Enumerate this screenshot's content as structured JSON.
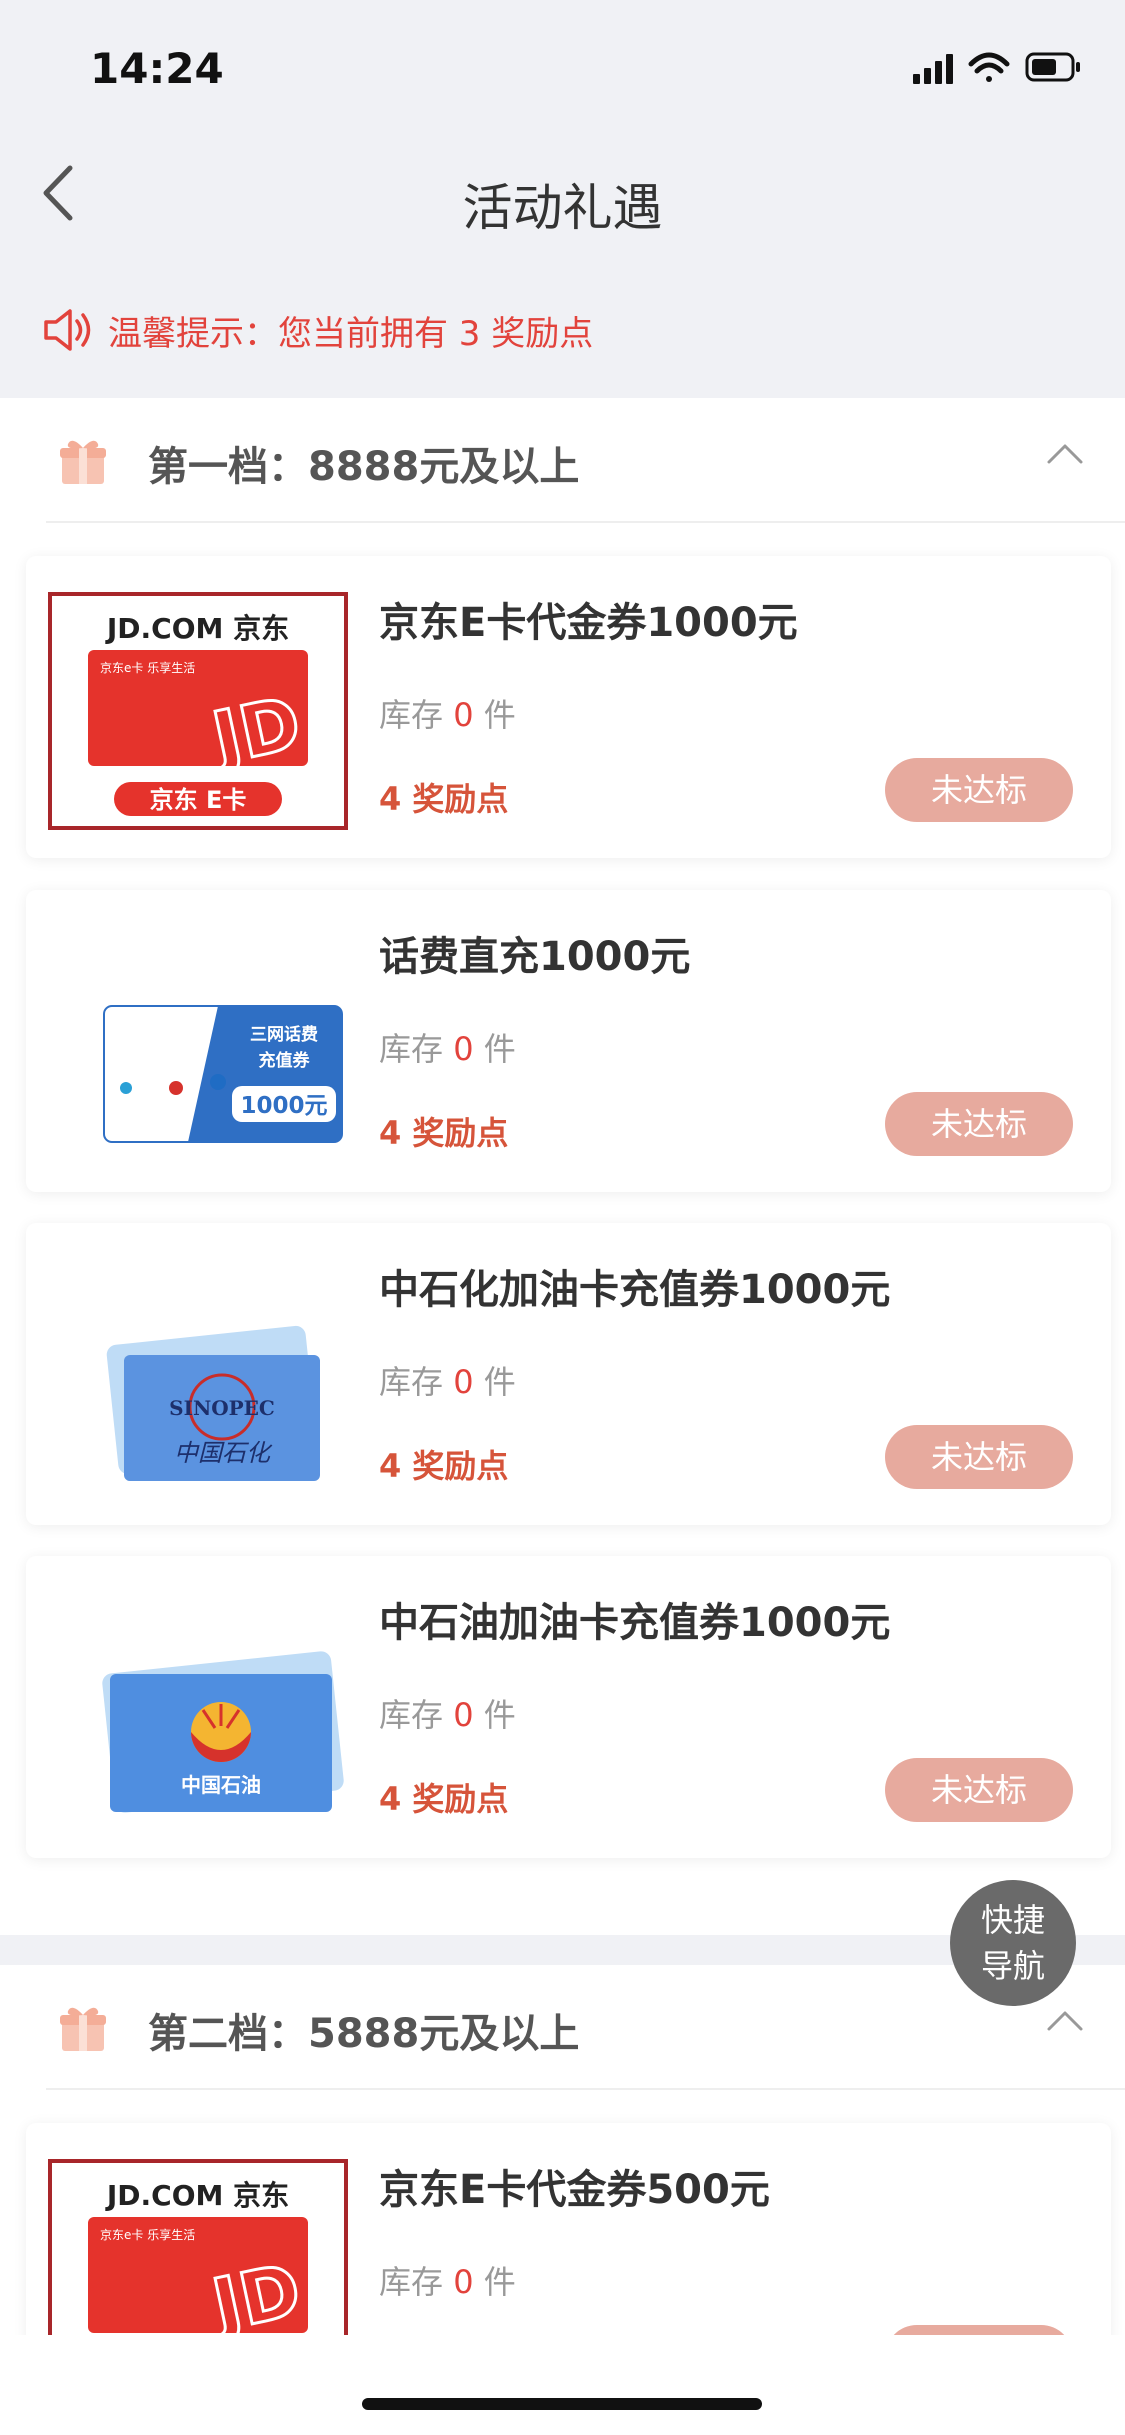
{
  "status": {
    "time": "14:24"
  },
  "nav": {
    "title": "活动礼遇"
  },
  "tip": {
    "text": "温馨提示：您当前拥有 3 奖励点"
  },
  "tiers": [
    {
      "label": "第一档：8888元及以上",
      "items": [
        {
          "name": "京东E卡代金券1000元",
          "stock_prefix": "库存 ",
          "stock_num": "0",
          "stock_suffix": " 件",
          "points": "4 奖励点",
          "button": "未达标"
        },
        {
          "name": "话费直充1000元",
          "stock_prefix": "库存 ",
          "stock_num": "0",
          "stock_suffix": " 件",
          "points": "4 奖励点",
          "button": "未达标"
        },
        {
          "name": "中石化加油卡充值券1000元",
          "stock_prefix": "库存 ",
          "stock_num": "0",
          "stock_suffix": " 件",
          "points": "4 奖励点",
          "button": "未达标"
        },
        {
          "name": "中石油加油卡充值券1000元",
          "stock_prefix": "库存 ",
          "stock_num": "0",
          "stock_suffix": " 件",
          "points": "4 奖励点",
          "button": "未达标"
        }
      ]
    },
    {
      "label": "第二档：5888元及以上",
      "items": [
        {
          "name": "京东E卡代金券500元",
          "stock_prefix": "库存 ",
          "stock_num": "0",
          "stock_suffix": " 件"
        }
      ]
    }
  ],
  "thumbs": {
    "jd": {
      "brand": "JD.COM 京东",
      "tagline": "京东e卡 乐享生活",
      "logo": "JD",
      "caption": "京东 E卡"
    },
    "phone": {
      "line1": "三网话费",
      "line2": "充值券",
      "amount": "1000元"
    },
    "sinopec": {
      "mark": "SINOPEC",
      "script": "中国石化"
    },
    "petro": {
      "name": "中国石油"
    }
  },
  "fab": {
    "line1": "快捷",
    "line2": "导航"
  },
  "colors": {
    "accent": "#e2433c",
    "points": "#d6543a",
    "button": "#e7aa9e",
    "background": "#f0f1f5"
  }
}
